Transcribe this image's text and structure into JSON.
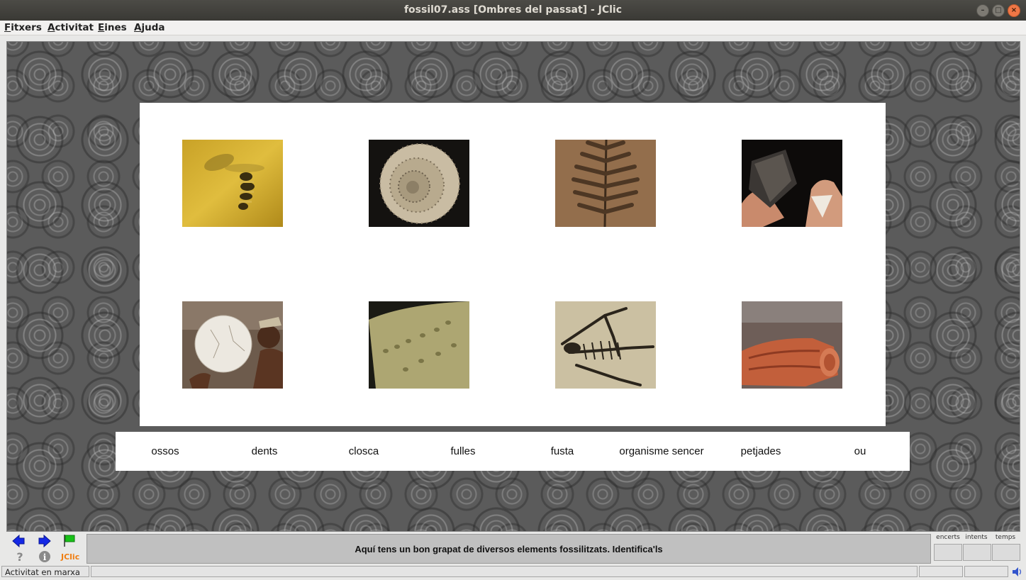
{
  "window": {
    "title": "fossil07.ass [Ombres del passat] - JClic"
  },
  "menu": {
    "items": [
      "Fitxers",
      "Activitat",
      "Eines",
      "Ajuda"
    ]
  },
  "activity": {
    "images": [
      {
        "name": "insect-in-amber"
      },
      {
        "name": "ammonite-shell"
      },
      {
        "name": "fern-leaf-fossil"
      },
      {
        "name": "shark-teeth-in-hands"
      },
      {
        "name": "giant-egg"
      },
      {
        "name": "footprints-on-rock"
      },
      {
        "name": "skeleton-fossil"
      },
      {
        "name": "petrified-wood"
      }
    ],
    "labels": [
      "ossos",
      "dents",
      "closca",
      "fulles",
      "fusta",
      "organisme sencer",
      "petjades",
      "ou"
    ]
  },
  "controls": {
    "message": "Aquí tens un bon grapat de diversos elements fossilitzats. Identifica'ls",
    "jclic_label": "JClic",
    "counters": [
      {
        "label": "encerts",
        "value": ""
      },
      {
        "label": "intents",
        "value": ""
      },
      {
        "label": "temps",
        "value": ""
      }
    ]
  },
  "status": {
    "text": "Activitat en marxa"
  }
}
